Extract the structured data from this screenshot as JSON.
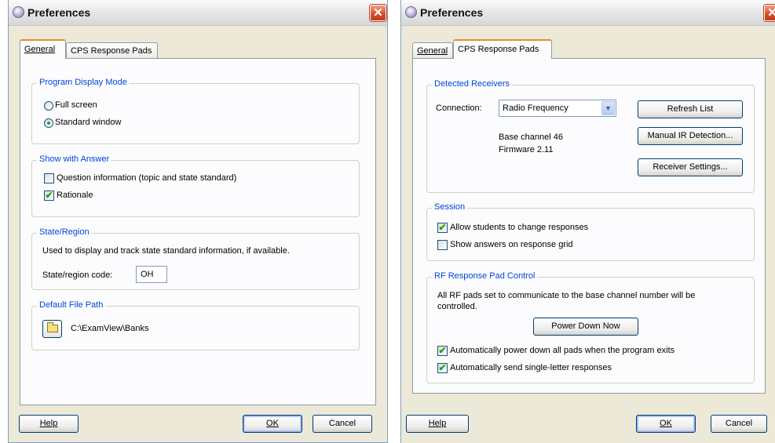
{
  "left_window": {
    "title": "Preferences",
    "close_glyph": "✕",
    "tabs": [
      {
        "label": "General",
        "active": true
      },
      {
        "label": "CPS Response Pads",
        "active": false
      }
    ],
    "display_mode": {
      "legend": "Program Display Mode",
      "options": [
        {
          "label": "Full screen",
          "checked": false
        },
        {
          "label": "Standard window",
          "checked": true
        }
      ]
    },
    "show_with_answer": {
      "legend": "Show with Answer",
      "options": [
        {
          "label": "Question information (topic and state standard)",
          "checked": false
        },
        {
          "label": "Rationale",
          "checked": true
        }
      ]
    },
    "state_region": {
      "legend": "State/Region",
      "description": "Used to display and track state standard information, if available.",
      "code_label": "State/region code:",
      "code_value": "OH"
    },
    "default_file_path": {
      "legend": "Default File Path",
      "icon": "folder-icon",
      "path": "C:\\ExamView\\Banks"
    },
    "buttons": {
      "help": "Help",
      "ok": "OK",
      "cancel": "Cancel"
    }
  },
  "right_window": {
    "title": "Preferences",
    "close_glyph": "✕",
    "tabs": [
      {
        "label": "General",
        "active": false
      },
      {
        "label": "CPS Response Pads",
        "active": true
      }
    ],
    "detected_receivers": {
      "legend": "Detected Receivers",
      "connection_label": "Connection:",
      "connection_value": "Radio Frequency",
      "base_channel": "Base channel 46",
      "firmware": "Firmware 2.11",
      "refresh_button": "Refresh List",
      "manual_ir_button": "Manual IR Detection...",
      "receiver_settings_button": "Receiver Settings..."
    },
    "session": {
      "legend": "Session",
      "options": [
        {
          "label": "Allow students to change responses",
          "checked": true
        },
        {
          "label": "Show answers on response grid",
          "checked": false
        }
      ]
    },
    "rf_control": {
      "legend": "RF Response Pad Control",
      "description": "All RF pads set to communicate to the base channel number will be controlled.",
      "power_down_button": "Power Down Now",
      "options": [
        {
          "label": "Automatically power down all pads when the program exits",
          "checked": true
        },
        {
          "label": "Automatically send single-letter responses",
          "checked": true
        }
      ]
    },
    "buttons": {
      "help": "Help",
      "ok": "OK",
      "cancel": "Cancel"
    }
  },
  "check_glyph": "✔"
}
